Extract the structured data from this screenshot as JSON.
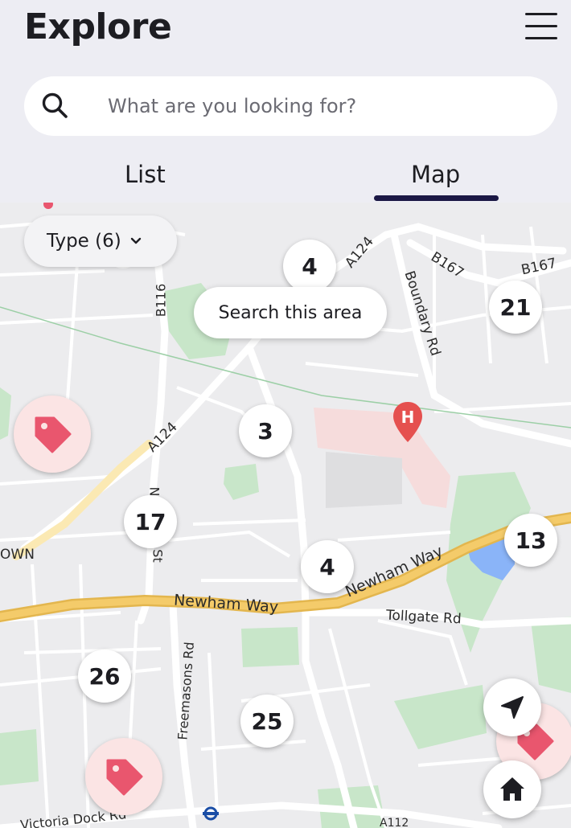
{
  "header": {
    "title": "Explore",
    "menu_icon": "hamburger-menu-icon"
  },
  "search": {
    "placeholder": "What are you looking for?",
    "icon": "search-icon"
  },
  "tabs": [
    {
      "label": "List",
      "active": false
    },
    {
      "label": "Map",
      "active": true
    }
  ],
  "map": {
    "type_filter": "Type (6)",
    "search_area_button": "Search this area",
    "clusters": [
      "4",
      "21",
      "3",
      "17",
      "4",
      "13",
      "26",
      "25"
    ],
    "road_labels": {
      "a124_top": "A124",
      "b167_a": "B167",
      "b167_b": "B167",
      "boundary_rd": "Boundary Rd",
      "b116": "B116",
      "a124_mid": "A124",
      "newham_way_left": "Newham Way",
      "newham_way_right": "Newham Way",
      "tollgate_rd": "Tollgate Rd",
      "freemasons_rd": "Freemasons Rd",
      "victoria_dock_rd": "Victoria Dock Rd",
      "own": "OWN",
      "st": "St",
      "n": "N",
      "a112": "A112"
    },
    "colors": {
      "tag_marker": "#E9566E",
      "hospital": "#E5504F",
      "motorway": "#F4CB6A",
      "park": "#C8E6C9",
      "water": "#8AB4F8"
    }
  },
  "fabs": {
    "locate_icon": "navigation-arrow-icon",
    "home_icon": "home-icon"
  }
}
